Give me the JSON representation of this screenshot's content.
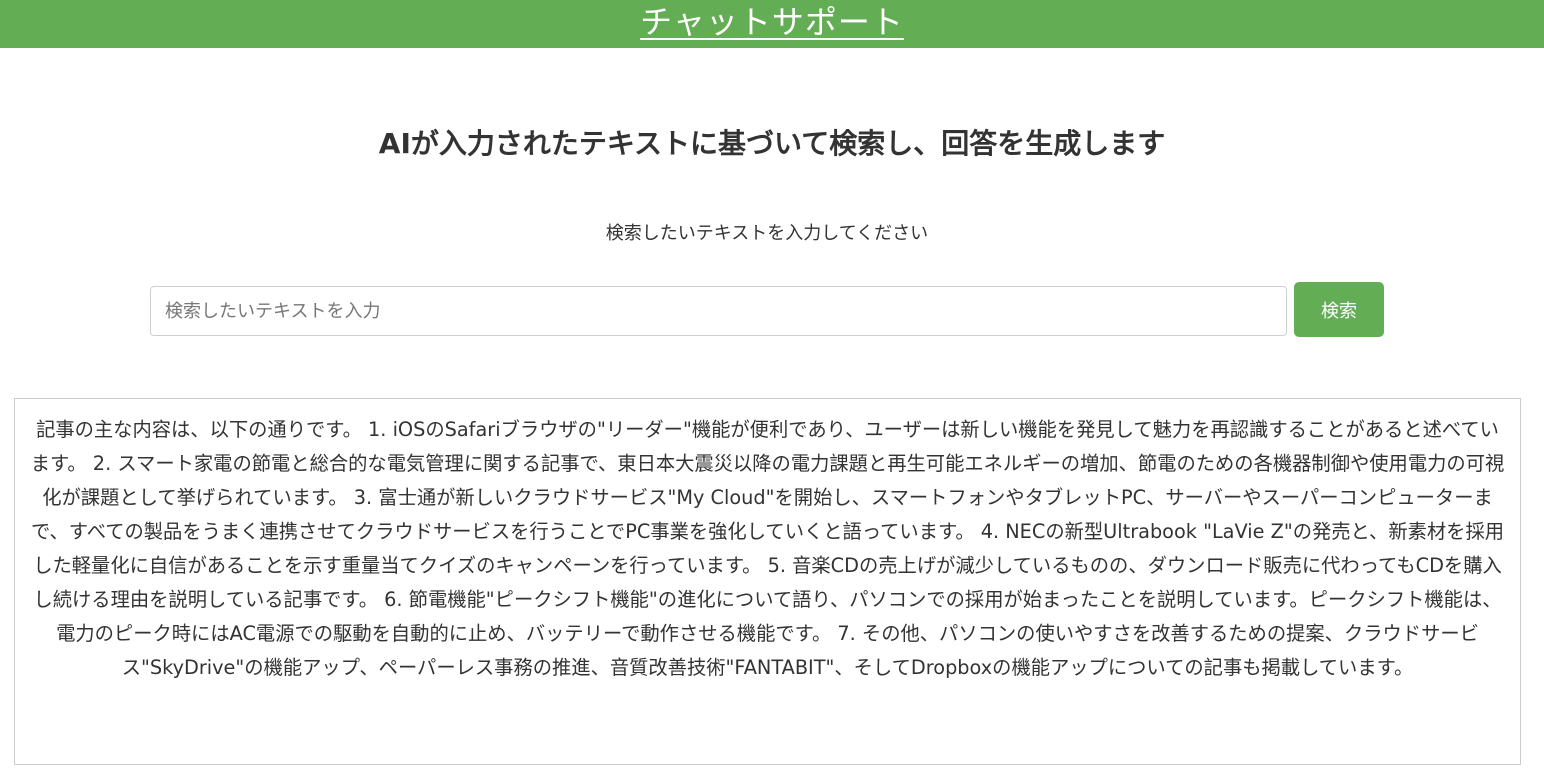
{
  "header": {
    "title": "チャットサポート",
    "color": "#63ad55"
  },
  "main": {
    "heading": "AIが入力されたテキストに基づいて検索し、回答を生成します",
    "prompt_label": "検索したいテキストを入力してください",
    "search": {
      "placeholder": "検索したいテキストを入力",
      "value": "",
      "button_label": "検索"
    },
    "result_text": "記事の主な内容は、以下の通りです。 1. iOSのSafariブラウザの\"リーダー\"機能が便利であり、ユーザーは新しい機能を発見して魅力を再認識することがあると述べています。 2. スマート家電の節電と総合的な電気管理に関する記事で、東日本大震災以降の電力課題と再生可能エネルギーの増加、節電のための各機器制御や使用電力の可視化が課題として挙げられています。 3. 富士通が新しいクラウドサービス\"My Cloud\"を開始し、スマートフォンやタブレットPC、サーバーやスーパーコンピューターまで、すべての製品をうまく連携させてクラウドサービスを行うことでPC事業を強化していくと語っています。 4. NECの新型Ultrabook \"LaVie Z\"の発売と、新素材を採用した軽量化に自信があることを示す重量当てクイズのキャンペーンを行っています。 5. 音楽CDの売上げが減少しているものの、ダウンロード販売に代わってもCDを購入し続ける理由を説明している記事です。 6. 節電機能\"ピークシフト機能\"の進化について語り、パソコンでの採用が始まったことを説明しています。ピークシフト機能は、電力のピーク時にはAC電源での駆動を自動的に止め、バッテリーで動作させる機能です。 7. その他、パソコンの使いやすさを改善するための提案、クラウドサービス\"SkyDrive\"の機能アップ、ペーパーレス事務の推進、音質改善技術\"FANTABIT\"、そしてDropboxの機能アップについての記事も掲載しています。"
  }
}
